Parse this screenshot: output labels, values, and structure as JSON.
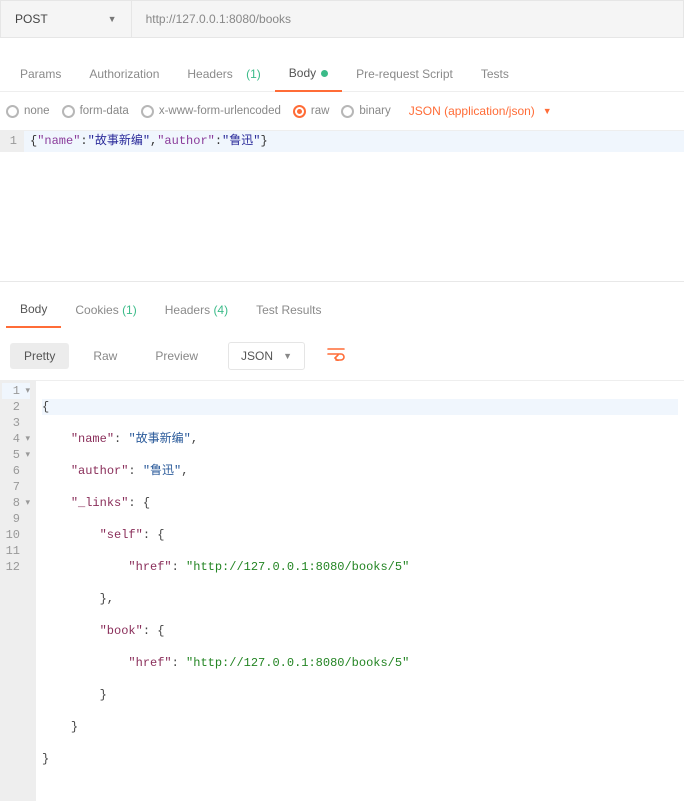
{
  "request": {
    "method": "POST",
    "url": "http://127.0.0.1:8080/books"
  },
  "tabs": {
    "params": "Params",
    "authorization": "Authorization",
    "headers": "Headers",
    "headers_count": "(1)",
    "body": "Body",
    "prerequest": "Pre-request Script",
    "tests": "Tests"
  },
  "body_types": {
    "none": "none",
    "formdata": "form-data",
    "urlencoded": "x-www-form-urlencoded",
    "raw": "raw",
    "binary": "binary",
    "content_type": "JSON (application/json)"
  },
  "request_editor": {
    "line_number": "1",
    "content": {
      "open": "{",
      "key_name": "\"name\"",
      "colon1": ":",
      "val_name": "\"故事新编\"",
      "comma": ",",
      "key_author": "\"author\"",
      "colon2": ":",
      "val_author": "\"鲁迅\"",
      "close": "}"
    }
  },
  "response_tabs": {
    "body": "Body",
    "cookies": "Cookies",
    "cookies_count": "(1)",
    "headers": "Headers",
    "headers_count": "(4)",
    "test_results": "Test Results"
  },
  "response_toolbar": {
    "pretty": "Pretty",
    "raw": "Raw",
    "preview": "Preview",
    "format": "JSON"
  },
  "response_body": {
    "lines": [
      "1",
      "2",
      "3",
      "4",
      "5",
      "6",
      "7",
      "8",
      "9",
      "10",
      "11",
      "12"
    ],
    "l1": "{",
    "l2_key": "\"name\"",
    "l2_val": "\"故事新编\"",
    "l3_key": "\"author\"",
    "l3_val": "\"鲁迅\"",
    "l4_key": "\"_links\"",
    "l5_key": "\"self\"",
    "l6_key": "\"href\"",
    "l6_val": "\"http://127.0.0.1:8080/books/5\"",
    "l8_key": "\"book\"",
    "l9_key": "\"href\"",
    "l9_val": "\"http://127.0.0.1:8080/books/5\"",
    "colon": ": ",
    "comma": ",",
    "brace_open": "{",
    "brace_close": "}",
    "close_comma": "},"
  }
}
